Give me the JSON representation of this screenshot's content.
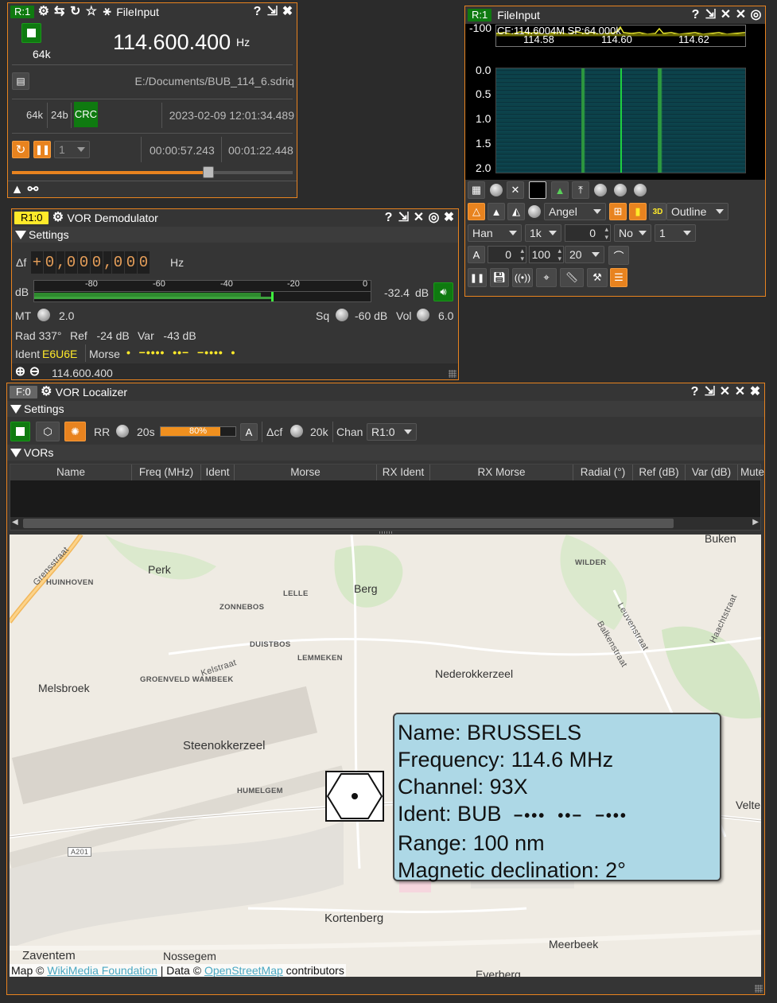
{
  "file_input": {
    "tag": "R:1",
    "title": "FileInput",
    "sample_rate": "64k",
    "frequency": "114.600.400",
    "freq_unit": "Hz",
    "file_path": "E:/Documents/BUB_114_6.sdriq",
    "sr_label": "64k",
    "bits_label": "24b",
    "crc_label": "CRC",
    "start_time": "2023-02-09 12:01:34.489",
    "accel": "1",
    "elapsed": "00:00:57.243",
    "total": "00:01:22.448",
    "progress": 0.7
  },
  "spectrum": {
    "tag": "R:1",
    "title": "FileInput",
    "ref_level": "-100",
    "cf_label": "CF:114.6004M SP:64.000k",
    "x_ticks": [
      "114.58",
      "114.60",
      "114.62"
    ],
    "y_ticks": [
      "0.0",
      "0.5",
      "1.0",
      "1.5",
      "2.0"
    ],
    "palette": "Angel",
    "style": "Outline",
    "window": "Han",
    "fft_size": "1k",
    "overlap": "0",
    "averaging": "No",
    "avg_count": "1",
    "auto_label": "A",
    "min_db": "0",
    "max_db": "100",
    "decay": "20",
    "three_d": "3D"
  },
  "vor_demod": {
    "tag": "R1:0",
    "title": "VOR Demodulator",
    "settings_label": "Settings",
    "delta_f_label": "Δf",
    "delta_f": [
      "+",
      "0",
      ",",
      "0",
      "0",
      "0",
      ",",
      "0",
      "0",
      "0"
    ],
    "hz": "Hz",
    "db_label": "dB",
    "meter_ticks": [
      "-80",
      "-60",
      "-40",
      "-20",
      "0"
    ],
    "level": "-32.4",
    "level_unit": "dB",
    "mt_label": "MT",
    "mt_value": "2.0",
    "sq_label": "Sq",
    "sq_value": "-60 dB",
    "vol_label": "Vol",
    "vol_value": "6.0",
    "rad": "Rad 337°",
    "ref": "Ref   -24 dB",
    "var": "Var   -43 dB",
    "ident_label": "Ident",
    "ident_value": "E6U6E",
    "morse_label": "Morse",
    "morse_value": "•  −••••  ••−  −••••  •",
    "footer_freq": "114.600.400"
  },
  "vor_localizer": {
    "tag": "F:0",
    "title": "VOR Localizer",
    "settings_label": "Settings",
    "rr_label": "RR",
    "rr_value": "20s",
    "rr_pct": "80%",
    "rr_progress": 0.8,
    "auto_label": "A",
    "dcf_label": "Δcf",
    "dcf_value": "20k",
    "chan_label": "Chan",
    "chan_value": "R1:0",
    "vors_label": "VORs",
    "columns": [
      "Name",
      "Freq (MHz)",
      "Ident",
      "Morse",
      "RX Ident",
      "RX Morse",
      "Radial (°)",
      "Ref (dB)",
      "Var (dB)",
      "Mute"
    ]
  },
  "map": {
    "labels": [
      "Perk",
      "Berg",
      "Melsbroek",
      "Steenokkerzeel",
      "Nederokkerzeel",
      "Kortenberg",
      "Zaventem",
      "Nossegem",
      "Meerbeek",
      "Buken",
      "Velte",
      "Everberg"
    ],
    "small_labels": [
      "HUINHOVEN",
      "LELLE",
      "ZONNEBOS",
      "DUISTBOS",
      "LEMMEKEN",
      "GROENVELD WAMBEEK",
      "HUMELGEM",
      "WILDER"
    ],
    "street_labels": [
      "Grensstraat",
      "Kelstraat",
      "Leuvenstraat",
      "Balkenstraat",
      "Haachtstraat",
      "A201"
    ],
    "attribution_prefix": "Map © ",
    "attribution_link1": "WikiMedia Foundation",
    "attribution_mid": " | Data © ",
    "attribution_link2": "OpenStreetMap",
    "attribution_suffix": " contributors",
    "popup": {
      "name": "Name: BRUSSELS",
      "frequency": "Frequency: 114.6 MHz",
      "channel": "Channel: 93X",
      "ident": "Ident: BUB",
      "ident_morse": "−•••  ••−  −•••",
      "range": "Range: 100 nm",
      "declination": "Magnetic declination: 2°"
    }
  },
  "colors": {
    "accent": "#e8831f",
    "green": "#0f7a10",
    "yellow": "#ffea2a",
    "popup": "#add8e6"
  }
}
